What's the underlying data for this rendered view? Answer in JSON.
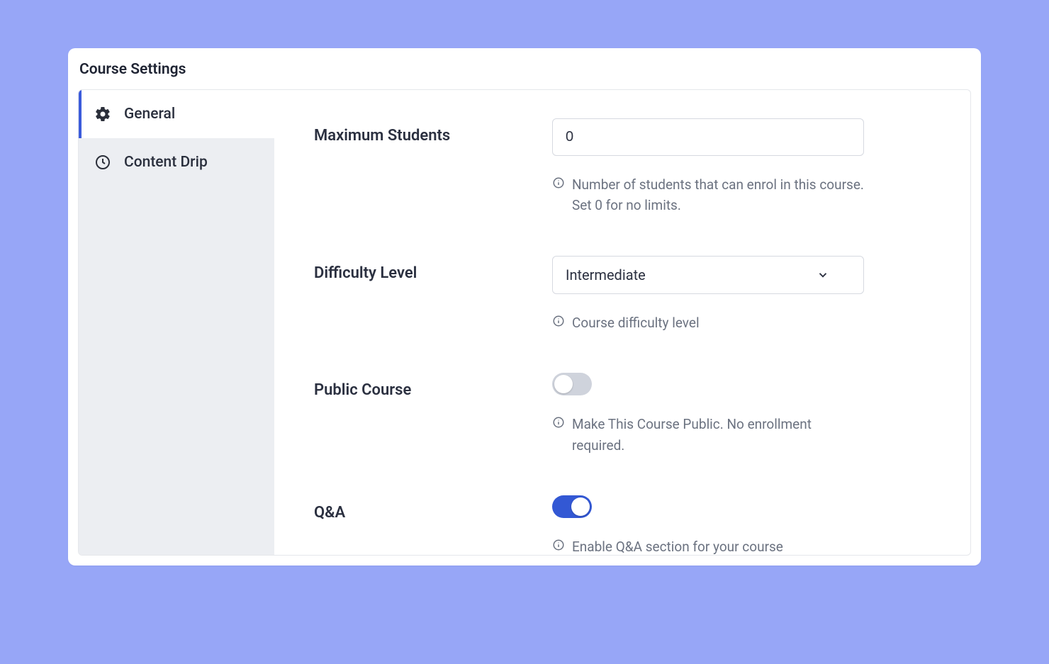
{
  "panel": {
    "title": "Course Settings"
  },
  "tabs": [
    {
      "id": "general",
      "label": "General",
      "icon": "gear",
      "active": true
    },
    {
      "id": "content-drip",
      "label": "Content Drip",
      "icon": "clock",
      "active": false
    }
  ],
  "fields": {
    "max_students": {
      "label": "Maximum Students",
      "value": "0",
      "hint": "Number of students that can enrol in this course. Set 0 for no limits."
    },
    "difficulty": {
      "label": "Difficulty Level",
      "value": "Intermediate",
      "hint": "Course difficulty level"
    },
    "public_course": {
      "label": "Public Course",
      "enabled": false,
      "hint": "Make This Course Public. No enrollment required."
    },
    "qa": {
      "label": "Q&A",
      "enabled": true,
      "hint": "Enable Q&A section for your course"
    }
  }
}
